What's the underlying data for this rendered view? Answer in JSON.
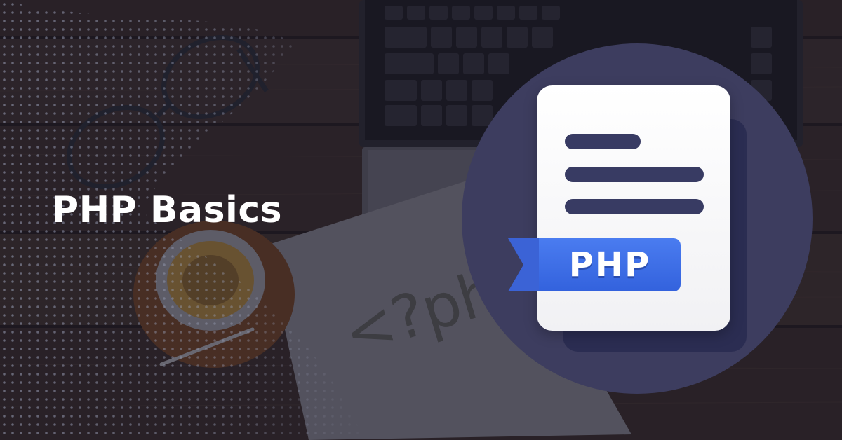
{
  "banner": {
    "title": "PHP Basics",
    "code_tag": "<?php",
    "badge_label": "PHP"
  },
  "icons": {
    "document": "php-document-icon",
    "ribbon": "ribbon-icon"
  },
  "colors": {
    "title_text": "#ffffff",
    "circle": "#3d3d5f",
    "doc_lines": "#383b63",
    "ribbon": "#3a6be6",
    "background": "#241b18"
  }
}
